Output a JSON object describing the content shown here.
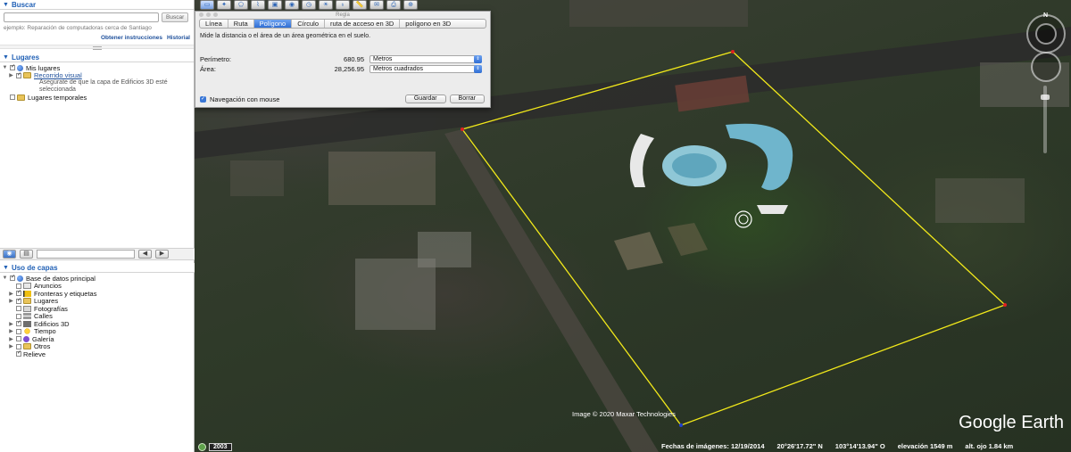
{
  "search": {
    "header": "Buscar",
    "button": "Buscar",
    "hint": "ejemplo: Reparación de computadoras cerca de Santiago",
    "link_instructions": "Obtener instrucciones",
    "link_history": "Historial"
  },
  "places": {
    "header": "Lugares",
    "my_places": "Mis lugares",
    "tour": "Recorrido visual",
    "tour_note": "Asegúrate de que la capa de Edificios 3D esté seleccionada",
    "temp_places": "Lugares temporales"
  },
  "layers": {
    "header": "Uso de capas",
    "root": "Base de datos principal",
    "items": [
      {
        "label": "Anuncios",
        "icon": "envelope-icon",
        "checked": false
      },
      {
        "label": "Fronteras y etiquetas",
        "icon": "flag-icon",
        "checked": true
      },
      {
        "label": "Lugares",
        "icon": "folder-icon",
        "checked": true
      },
      {
        "label": "Fotografías",
        "icon": "camera-icon",
        "checked": false
      },
      {
        "label": "Calles",
        "icon": "road-icon",
        "checked": false
      },
      {
        "label": "Edificios 3D",
        "icon": "building-icon",
        "checked": true
      },
      {
        "label": "Tiempo",
        "icon": "sun-icon",
        "checked": false
      },
      {
        "label": "Galería",
        "icon": "gallery-icon",
        "checked": false
      },
      {
        "label": "Otros",
        "icon": "folder-icon",
        "checked": false
      }
    ],
    "relief": "Relieve"
  },
  "ruler": {
    "title": "Regla",
    "tabs": [
      "Línea",
      "Ruta",
      "Polígono",
      "Círculo",
      "ruta de acceso en 3D",
      "polígono en 3D"
    ],
    "active_tab": "Polígono",
    "description": "Mide la distancia o el área de un área geométrica en el suelo.",
    "perimeter_label": "Perímetro:",
    "perimeter_value": "680.95",
    "perimeter_unit": "Metros",
    "area_label": "Área:",
    "area_value": "28,256.95",
    "area_unit": "Metros cuadrados",
    "mouse_nav": "Navegación con mouse",
    "save": "Guardar",
    "clear": "Borrar"
  },
  "map": {
    "north_label": "N",
    "attribution": "Image © 2020 Maxar Technologies",
    "brand": "Google Earth",
    "year": "2003",
    "status": {
      "imagery_date": "Fechas de imágenes: 12/19/2014",
      "lat": "20°26'17.72\" N",
      "lon": "103°14'13.94\" O",
      "elevation": "elevación  1549 m",
      "eye_alt": "alt. ojo  1.84 km"
    },
    "polygon_color": "#f2e91a",
    "vertex_color": "#e02020"
  }
}
